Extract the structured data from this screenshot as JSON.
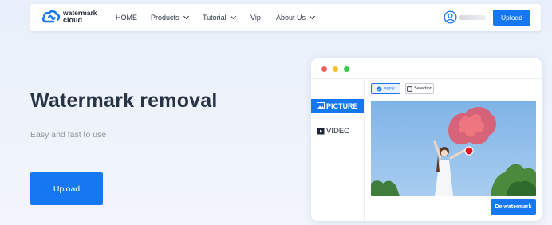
{
  "brand": {
    "line1": "watermark",
    "line2": "cloud",
    "icon": "cloud-logo-icon"
  },
  "nav": {
    "home": "HOME",
    "products": "Products",
    "tutorial": "Tutorial",
    "vip": "Vip",
    "about": "About Us",
    "upload": "Upload"
  },
  "user": {
    "icon": "user-avatar-icon"
  },
  "hero": {
    "title": "Watermark removal",
    "subtitle": "Easy and fast to use",
    "upload": "Upload"
  },
  "preview": {
    "sidebar": {
      "picture": "PICTURE",
      "video": "VIDEO"
    },
    "toolbar": {
      "apply": "apply",
      "selection": "Selection"
    },
    "action": "De watermark"
  },
  "colors": {
    "accent": "#1677f2",
    "background": "#eaf0fa",
    "dot_red": "#f25f58",
    "dot_yellow": "#fbbe2f",
    "dot_green": "#36c84a"
  }
}
